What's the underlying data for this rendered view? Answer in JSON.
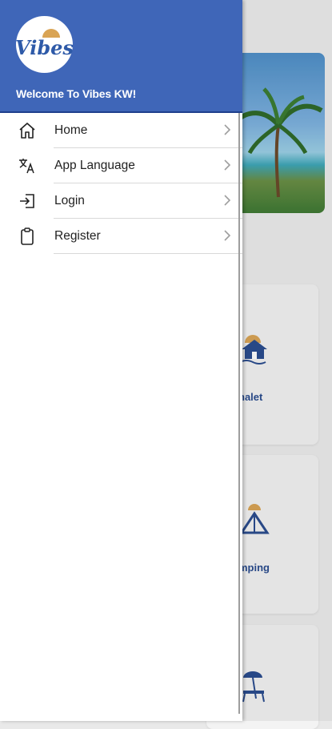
{
  "background": {
    "cards": [
      {
        "label": "halet",
        "icon": "chalet-icon"
      },
      {
        "label": "mping",
        "icon": "camping-tent-icon"
      },
      {
        "label": "",
        "icon": "beach-chair-icon"
      }
    ],
    "hero_image": "palm-beach-image"
  },
  "drawer": {
    "logo_text": "Vibes",
    "welcome": "Welcome To Vibes KW!",
    "items": [
      {
        "label": "Home",
        "icon": "home-icon"
      },
      {
        "label": "App Language",
        "icon": "translate-icon"
      },
      {
        "label": "Login",
        "icon": "login-icon"
      },
      {
        "label": "Register",
        "icon": "clipboard-icon"
      }
    ]
  },
  "colors": {
    "header": "#3f66b8",
    "accent": "#2b4d8f",
    "logo_sun": "#d9a455"
  }
}
